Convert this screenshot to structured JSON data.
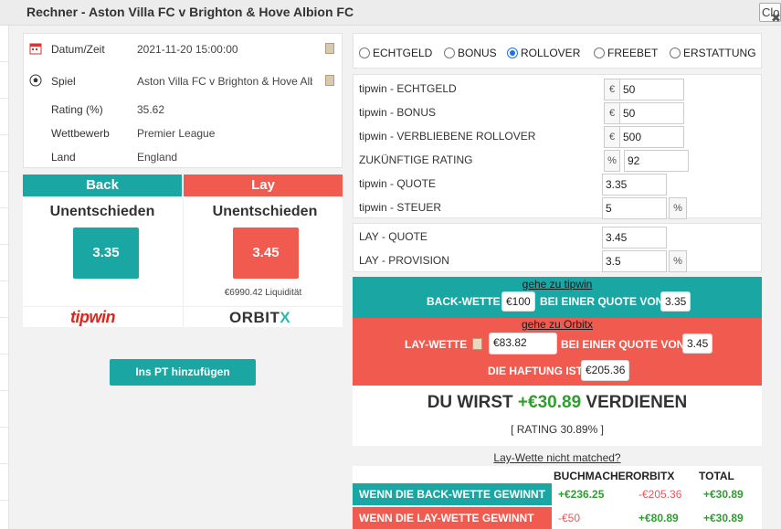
{
  "window": {
    "title": "Rechner - Aston Villa FC v Brighton & Hove Albion FC",
    "close_label": "Close"
  },
  "event": {
    "datetime_label": "Datum/Zeit",
    "datetime_value": "2021-11-20 15:00:00",
    "game_label": "Spiel",
    "game_value": "Aston Villa FC v Brighton & Hove Albion FC",
    "rating_label": "Rating (%)",
    "rating_value": "35.62",
    "competition_label": "Wettbewerb",
    "competition_value": "Premier League",
    "country_label": "Land",
    "country_value": "England"
  },
  "back": {
    "header": "Back",
    "selection": "Unentschieden",
    "odds": "3.35",
    "bookmaker": "tipwin"
  },
  "lay": {
    "header": "Lay",
    "selection": "Unentschieden",
    "odds": "3.45",
    "liquidity": "€6990.42 Liquidität",
    "exchange_main": "ORBIT",
    "exchange_x": "X"
  },
  "add_button": "Ins PT hinzufügen",
  "modes": [
    {
      "label": "ECHTGELD",
      "selected": false
    },
    {
      "label": "BONUS",
      "selected": false
    },
    {
      "label": "ROLLOVER",
      "selected": true
    },
    {
      "label": "FREEBET",
      "selected": false
    },
    {
      "label": "ERSTATTUNG",
      "selected": false
    }
  ],
  "form": {
    "real_money_label": "tipwin - ECHTGELD",
    "real_money_value": "50",
    "bonus_label": "tipwin - BONUS",
    "bonus_value": "50",
    "rollover_label": "tipwin - VERBLIEBENE ROLLOVER",
    "rollover_value": "500",
    "future_rating_label": "ZUKÜNFTIGE RATING",
    "future_rating_value": "92",
    "odds_label": "tipwin - QUOTE",
    "odds_value": "3.35",
    "tax_label": "tipwin - STEUER",
    "tax_value": "5",
    "lay_odds_label": "LAY - QUOTE",
    "lay_odds_value": "3.45",
    "commission_label": "LAY - PROVISION",
    "commission_value": "3.5",
    "euro": "€",
    "percent": "%"
  },
  "back_strip": {
    "link": "gehe zu tipwin",
    "label": "BACK-WETTE",
    "stake": "€100",
    "at_odds": "BEI EINER QUOTE VON",
    "odds": "3.35"
  },
  "lay_strip": {
    "link": "gehe zu Orbitx",
    "label": "LAY-WETTE",
    "stake": "€83.82",
    "at_odds": "BEI EINER QUOTE VON",
    "odds": "3.45",
    "liability_label": "DIE HAFTUNG IST",
    "liability": "€205.36"
  },
  "result": {
    "prefix": "DU WIRST",
    "amount": "+€30.89",
    "suffix": "VERDIENEN",
    "rating": "[ RATING 30.89% ]"
  },
  "not_matched": "Lay-Wette nicht matched?",
  "table": {
    "headers": [
      "BUCHMACHER",
      "ORBITX",
      "TOTAL"
    ],
    "rows": [
      {
        "label": "WENN DIE BACK-WETTE GEWINNT",
        "bookmaker": "+€236.25",
        "exchange": "-€205.36",
        "total": "+€30.89"
      },
      {
        "label": "WENN DIE LAY-WETTE GEWINNT",
        "bookmaker": "-€50",
        "exchange": "+€80.89",
        "total": "+€30.89"
      }
    ]
  },
  "colors": {
    "teal": "#1aa7a4",
    "red": "#f05a4f",
    "green": "#2e9e2e"
  }
}
